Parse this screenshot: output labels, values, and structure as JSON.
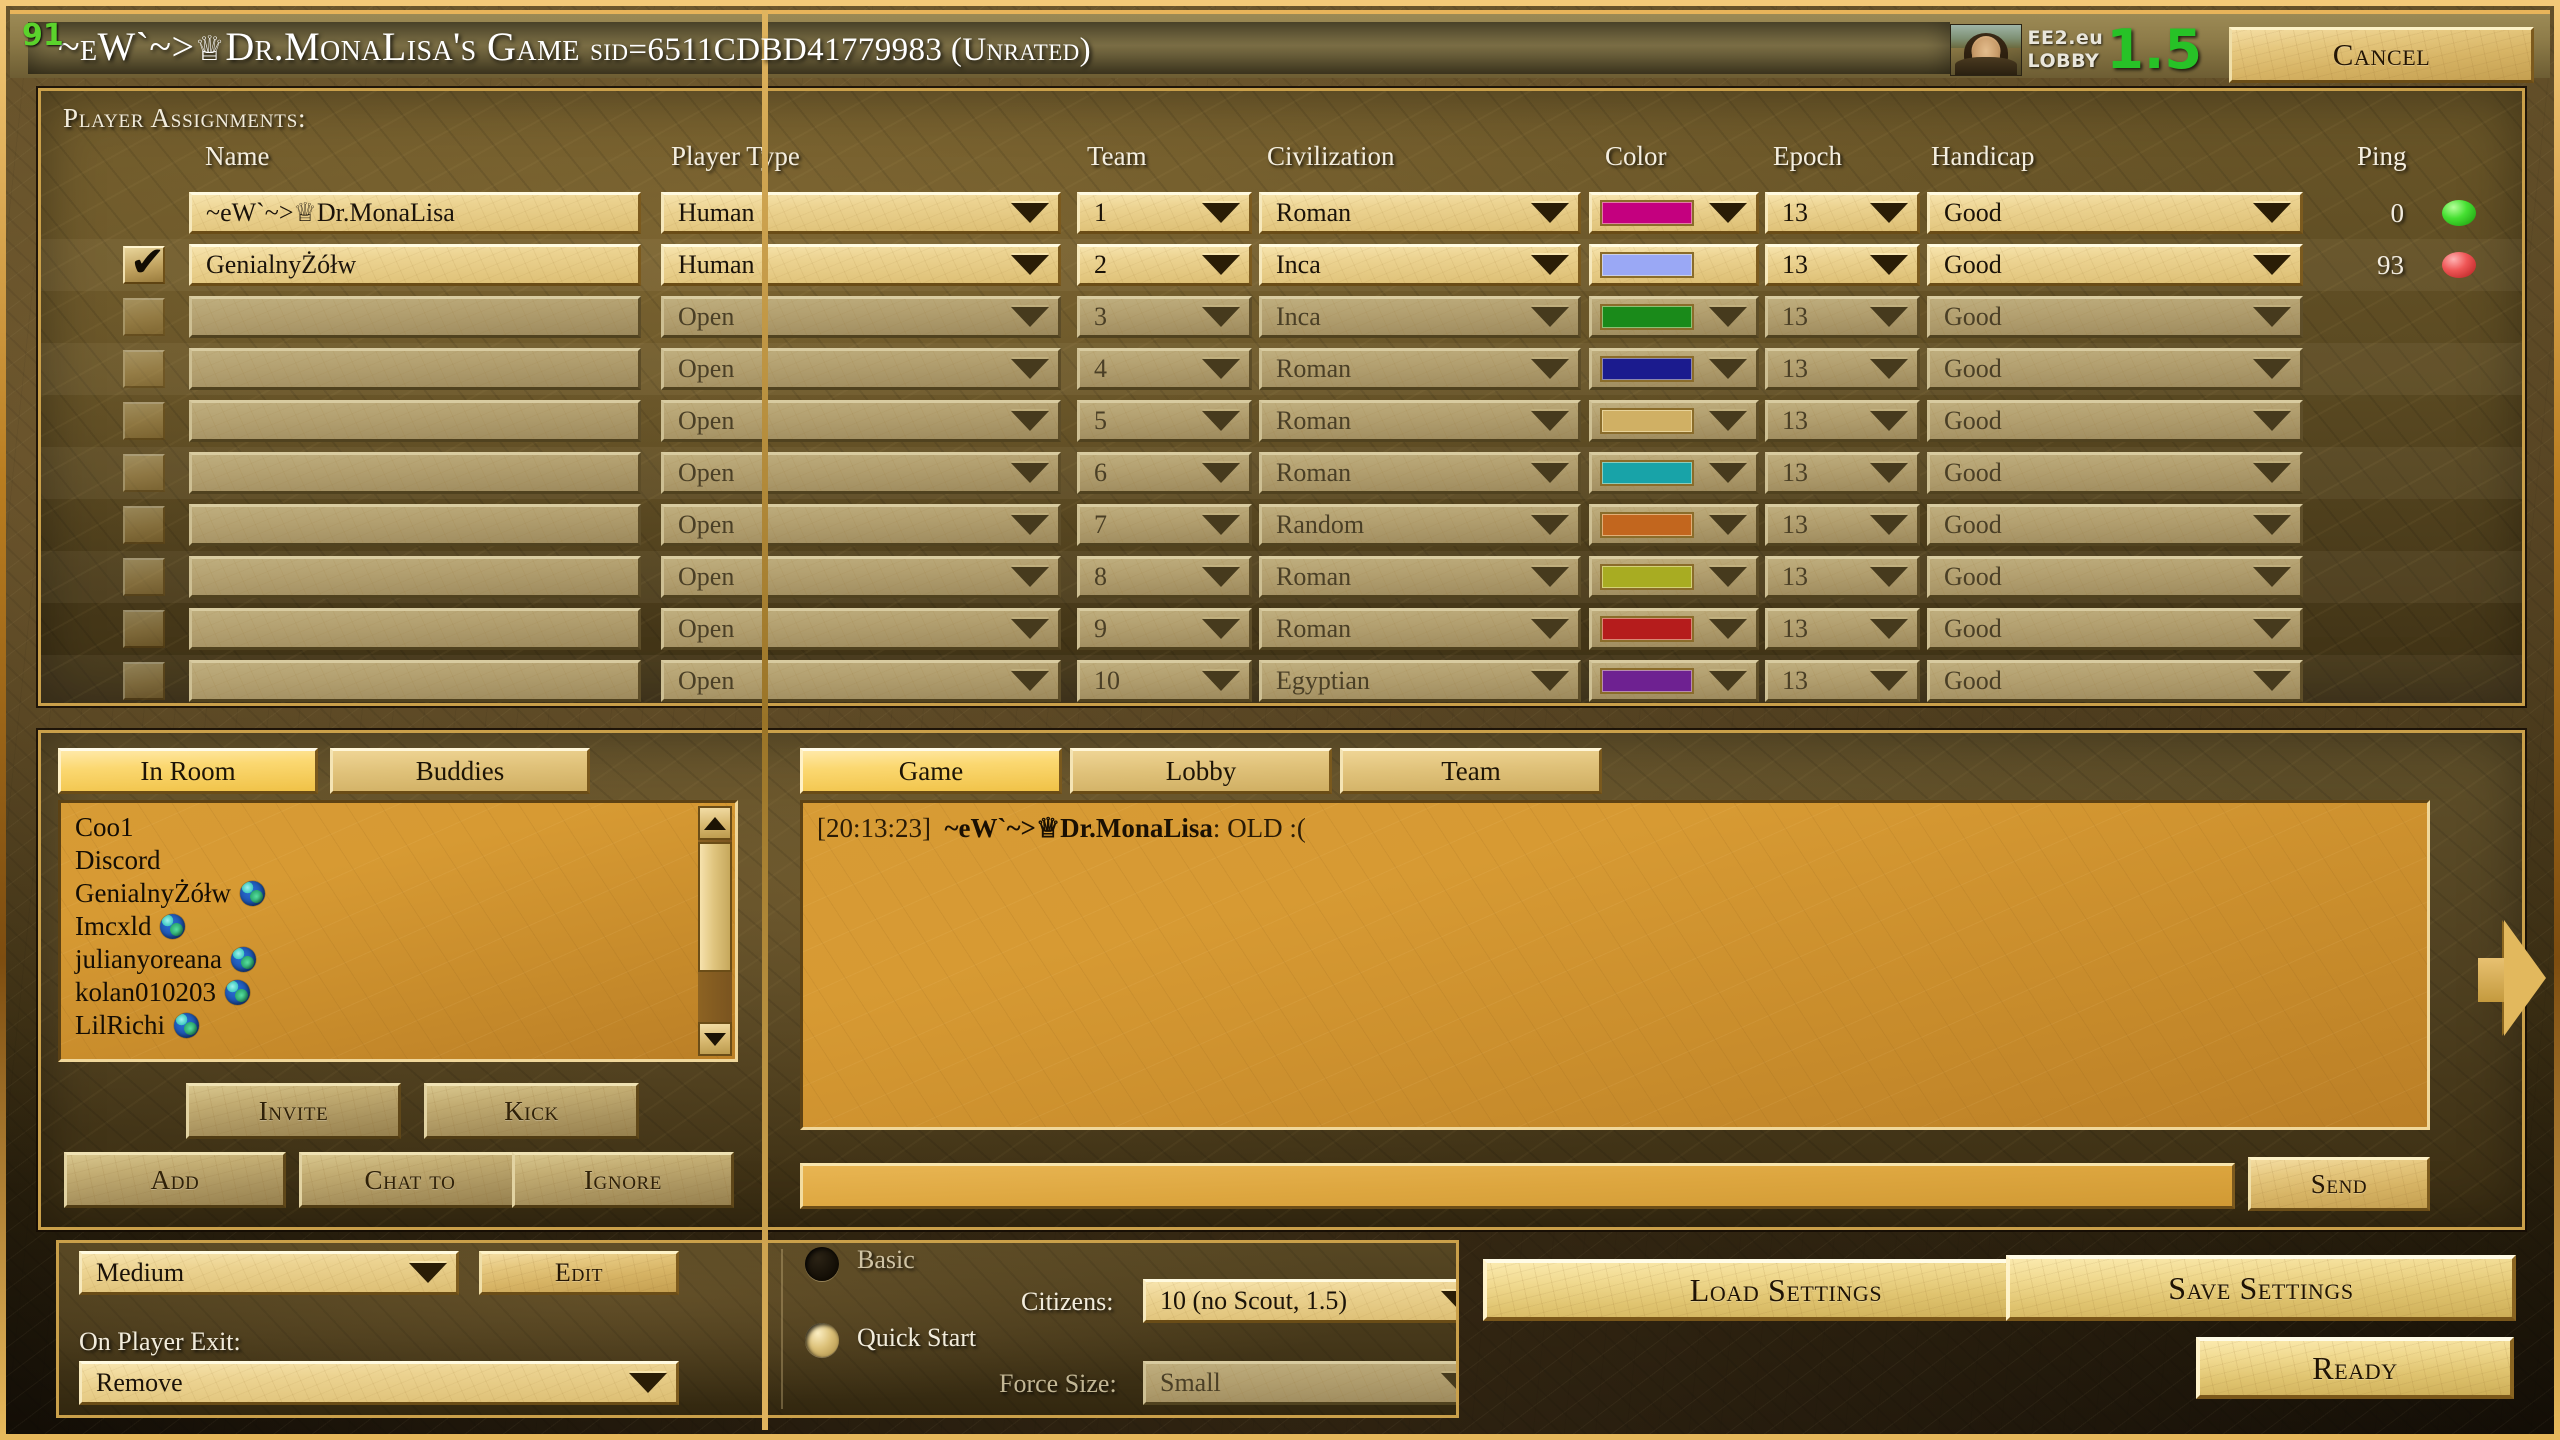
{
  "window": {
    "corner_number": "91",
    "title_prefix": "~eW`~>",
    "title_crown": "♕",
    "title_main": "Dr.MonaLisa's Game ",
    "title_sid": "sid=6511CDBD41779983 (Unrated)",
    "cancel_label": "Cancel"
  },
  "brand": {
    "line1": "EE2.eu",
    "line2": "LOBBY",
    "version": "1.5",
    "avatar_icon": "mona-lisa-portrait"
  },
  "players_panel": {
    "label": "Player Assignments:",
    "columns": [
      "Name",
      "Player Type",
      "Team",
      "Civilization",
      "Color",
      "Epoch",
      "Handicap",
      "Ping"
    ],
    "rows": [
      {
        "checked": false,
        "checkbox_visible": false,
        "name": "~eW`~>♕Dr.MonaLisa",
        "type": "Human",
        "team": "1",
        "civ": "Roman",
        "color": "#c4007f",
        "epoch": "13",
        "handicap": "Good",
        "ping": "0",
        "led": "green",
        "active": true,
        "color_caret": true
      },
      {
        "checked": true,
        "checkbox_visible": true,
        "name": "GenialnyŻółw",
        "type": "Human",
        "team": "2",
        "civ": "Inca",
        "color": "#9aa8f5",
        "epoch": "13",
        "handicap": "Good",
        "ping": "93",
        "led": "red",
        "active": true,
        "color_caret": false
      },
      {
        "checked": false,
        "checkbox_visible": true,
        "name": "",
        "type": "Open",
        "team": "3",
        "civ": "Inca",
        "color": "#1a8a1a",
        "epoch": "13",
        "handicap": "Good",
        "ping": "",
        "led": "",
        "active": false,
        "color_caret": true
      },
      {
        "checked": false,
        "checkbox_visible": true,
        "name": "",
        "type": "Open",
        "team": "4",
        "civ": "Roman",
        "color": "#1b1b8e",
        "epoch": "13",
        "handicap": "Good",
        "ping": "",
        "led": "",
        "active": false,
        "color_caret": true
      },
      {
        "checked": false,
        "checkbox_visible": true,
        "name": "",
        "type": "Open",
        "team": "5",
        "civ": "Roman",
        "color": "#d0b064",
        "epoch": "13",
        "handicap": "Good",
        "ping": "",
        "led": "",
        "active": false,
        "color_caret": true
      },
      {
        "checked": false,
        "checkbox_visible": true,
        "name": "",
        "type": "Open",
        "team": "6",
        "civ": "Roman",
        "color": "#18a3a8",
        "epoch": "13",
        "handicap": "Good",
        "ping": "",
        "led": "",
        "active": false,
        "color_caret": true
      },
      {
        "checked": false,
        "checkbox_visible": true,
        "name": "",
        "type": "Open",
        "team": "7",
        "civ": "Random",
        "color": "#c2661e",
        "epoch": "13",
        "handicap": "Good",
        "ping": "",
        "led": "",
        "active": false,
        "color_caret": true
      },
      {
        "checked": false,
        "checkbox_visible": true,
        "name": "",
        "type": "Open",
        "team": "8",
        "civ": "Roman",
        "color": "#a8ac22",
        "epoch": "13",
        "handicap": "Good",
        "ping": "",
        "led": "",
        "active": false,
        "color_caret": true
      },
      {
        "checked": false,
        "checkbox_visible": true,
        "name": "",
        "type": "Open",
        "team": "9",
        "civ": "Roman",
        "color": "#b51c1c",
        "epoch": "13",
        "handicap": "Good",
        "ping": "",
        "led": "",
        "active": false,
        "color_caret": true
      },
      {
        "checked": false,
        "checkbox_visible": true,
        "name": "",
        "type": "Open",
        "team": "10",
        "civ": "Egyptian",
        "color": "#6e2191",
        "epoch": "13",
        "handicap": "Good",
        "ping": "",
        "led": "",
        "active": false,
        "color_caret": true
      }
    ]
  },
  "chat": {
    "left_tabs": [
      {
        "label": "In Room",
        "active": true
      },
      {
        "label": "Buddies",
        "active": false
      }
    ],
    "right_tabs": [
      {
        "label": "Game",
        "active": true
      },
      {
        "label": "Lobby",
        "active": false
      },
      {
        "label": "Team",
        "active": false
      }
    ],
    "users": [
      {
        "name": "Coo1",
        "globe": false
      },
      {
        "name": "Discord",
        "globe": false
      },
      {
        "name": "GenialnyŻółw",
        "globe": true
      },
      {
        "name": "Imcxld",
        "globe": true
      },
      {
        "name": "julianyoreana",
        "globe": true
      },
      {
        "name": "kolan010203",
        "globe": true
      },
      {
        "name": "LilRichi",
        "globe": true
      }
    ],
    "messages": [
      {
        "time": "[20:13:23]",
        "author": "~eW`~>♕Dr.MonaLisa",
        "text": "OLD :("
      }
    ],
    "input_value": "",
    "input_placeholder": "",
    "send_label": "Send",
    "buttons_row1": [
      "Invite",
      "Kick"
    ],
    "buttons_row2": [
      "Add",
      "Chat to",
      "Ignore"
    ]
  },
  "settings": {
    "difficulty_value": "Medium",
    "edit_label": "Edit",
    "on_player_exit_label": "On Player Exit:",
    "on_player_exit_value": "Remove",
    "start_basic_label": "Basic",
    "start_quick_label": "Quick Start",
    "citizens_label": "Citizens:",
    "citizens_value": "10 (no Scout, 1.5)",
    "force_size_label": "Force Size:",
    "force_size_value": "Small"
  },
  "actions": {
    "load_settings": "Load Settings",
    "save_settings": "Save Settings",
    "ready": "Ready"
  }
}
